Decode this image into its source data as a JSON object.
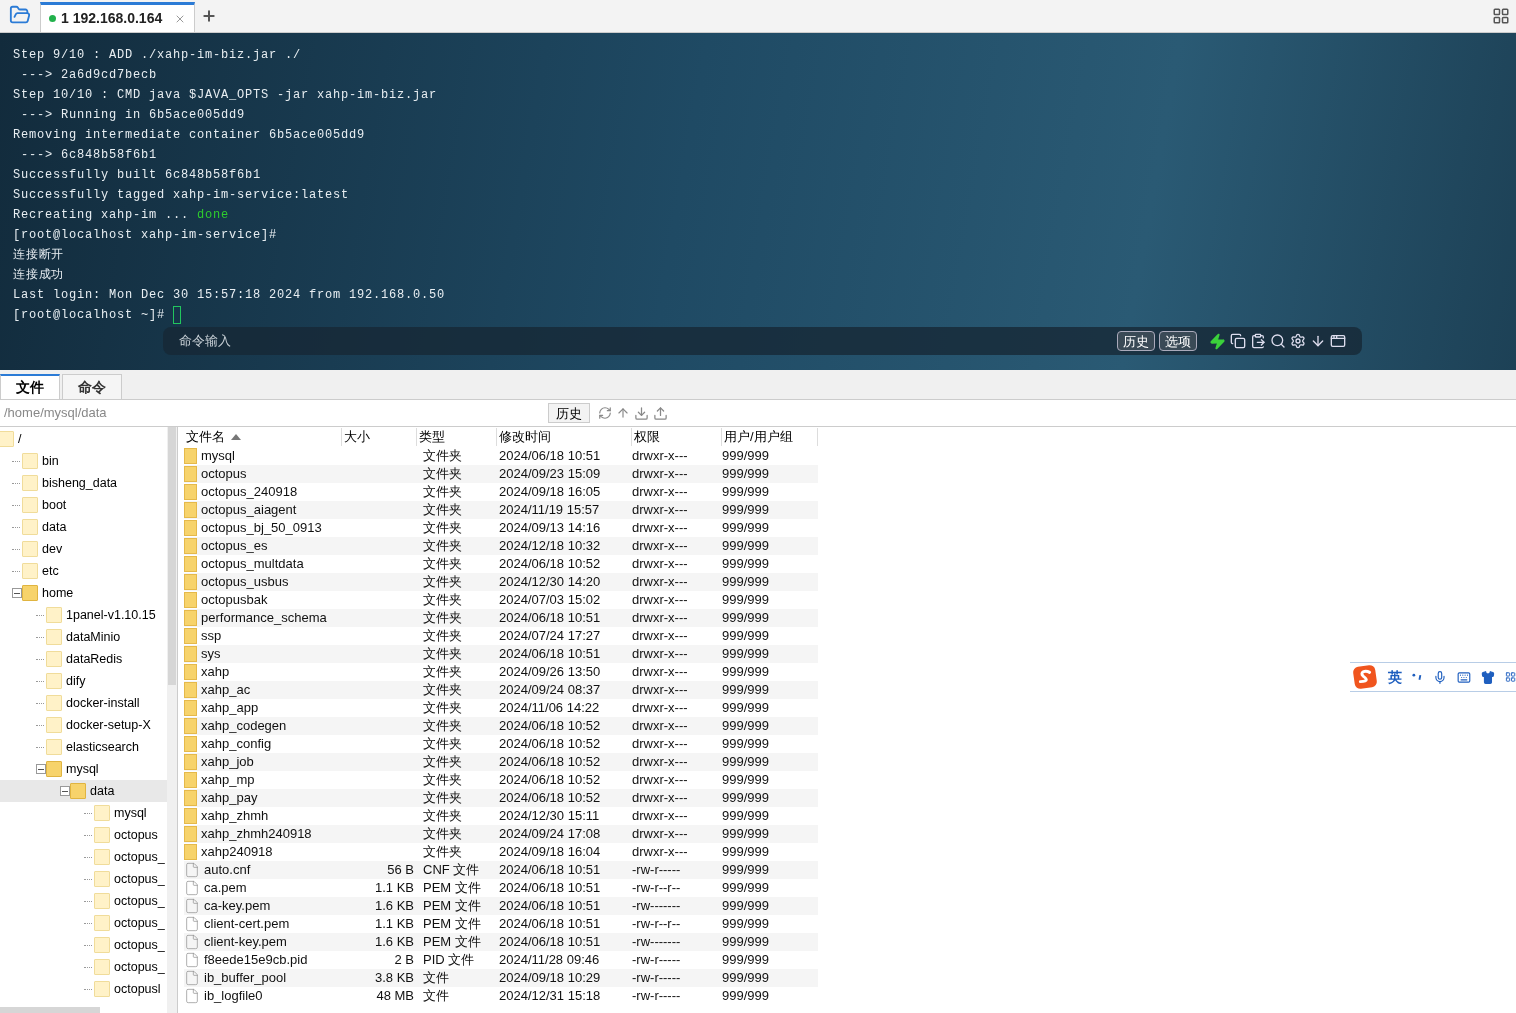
{
  "session_tabs": [
    {
      "label": "1 192.168.0.164",
      "connected": true,
      "selected": true
    }
  ],
  "terminal": {
    "lines": [
      {
        "text": "Step 9/10 : ADD ./xahp-im-biz.jar ./"
      },
      {
        "text": " ---> 2a6d9cd7becb"
      },
      {
        "text": "Step 10/10 : CMD java $JAVA_OPTS -jar xahp-im-biz.jar"
      },
      {
        "text": " ---> Running in 6b5ace005dd9"
      },
      {
        "text": "Removing intermediate container 6b5ace005dd9"
      },
      {
        "text": " ---> 6c848b58f6b1"
      },
      {
        "text": "Successfully built 6c848b58f6b1"
      },
      {
        "text": "Successfully tagged xahp-im-service:latest"
      },
      {
        "text": "Recreating xahp-im ... ",
        "status": "done"
      },
      {
        "text": "[root@localhost xahp-im-service]#"
      },
      {
        "text": "连接断开"
      },
      {
        "text": "连接成功"
      },
      {
        "text": "Last login: Mon Dec 30 15:57:18 2024 from 192.168.0.50"
      },
      {
        "text": "[root@localhost ~]# ",
        "cursor": true
      }
    ],
    "command_bar": {
      "placeholder": "命令输入",
      "buttons": [
        "历史",
        "选项"
      ]
    }
  },
  "panel_tabs": [
    {
      "label": "文件",
      "selected": true
    },
    {
      "label": "命令",
      "selected": false
    }
  ],
  "path_bar": {
    "value": "/home/mysql/data",
    "history_button": "历史"
  },
  "tree": [
    {
      "label": "/",
      "selected": false,
      "children": [
        {
          "label": "bin",
          "selected": false
        },
        {
          "label": "bisheng_data",
          "selected": false
        },
        {
          "label": "boot",
          "selected": false
        },
        {
          "label": "data",
          "selected": false
        },
        {
          "label": "dev",
          "selected": false
        },
        {
          "label": "etc",
          "selected": false
        },
        {
          "label": "home",
          "expanded": true,
          "selected": false,
          "children": [
            {
              "label": "1panel-v1.10.15",
              "selected": false
            },
            {
              "label": "dataMinio",
              "selected": false
            },
            {
              "label": "dataRedis",
              "selected": false
            },
            {
              "label": "dify",
              "selected": false
            },
            {
              "label": "docker-install",
              "selected": false
            },
            {
              "label": "docker-setup-X",
              "selected": false
            },
            {
              "label": "elasticsearch",
              "selected": false
            },
            {
              "label": "mysql",
              "expanded": true,
              "selected": false,
              "children": [
                {
                  "label": "data",
                  "expanded": true,
                  "selected": true,
                  "children": [
                    {
                      "label": "mysql",
                      "selected": false
                    },
                    {
                      "label": "octopus",
                      "selected": false
                    },
                    {
                      "label": "octopus_",
                      "selected": false
                    },
                    {
                      "label": "octopus_",
                      "selected": false
                    },
                    {
                      "label": "octopus_",
                      "selected": false
                    },
                    {
                      "label": "octopus_",
                      "selected": false
                    },
                    {
                      "label": "octopus_",
                      "selected": false
                    },
                    {
                      "label": "octopus_",
                      "selected": false
                    },
                    {
                      "label": "octopusl",
                      "selected": false
                    }
                  ]
                }
              ]
            }
          ]
        }
      ]
    }
  ],
  "table": {
    "columns": [
      {
        "label": "文件名",
        "sorted": true
      },
      {
        "label": "大小",
        "sorted": false
      },
      {
        "label": "类型",
        "sorted": false
      },
      {
        "label": "修改时间",
        "sorted": false
      },
      {
        "label": "权限",
        "sorted": false
      },
      {
        "label": "用户/用户组",
        "sorted": false
      }
    ],
    "rows": [
      {
        "kind": "folder",
        "name": "mysql",
        "type": "文件夹",
        "modified": "2024/06/18 10:51",
        "permissions": "drwxr-x---",
        "owner": "999/999"
      },
      {
        "kind": "folder",
        "name": "octopus",
        "type": "文件夹",
        "modified": "2024/09/23 15:09",
        "permissions": "drwxr-x---",
        "owner": "999/999"
      },
      {
        "kind": "folder",
        "name": "octopus_240918",
        "type": "文件夹",
        "modified": "2024/09/18 16:05",
        "permissions": "drwxr-x---",
        "owner": "999/999"
      },
      {
        "kind": "folder",
        "name": "octopus_aiagent",
        "type": "文件夹",
        "modified": "2024/11/19 15:57",
        "permissions": "drwxr-x---",
        "owner": "999/999"
      },
      {
        "kind": "folder",
        "name": "octopus_bj_50_0913",
        "type": "文件夹",
        "modified": "2024/09/13 14:16",
        "permissions": "drwxr-x---",
        "owner": "999/999"
      },
      {
        "kind": "folder",
        "name": "octopus_es",
        "type": "文件夹",
        "modified": "2024/12/18 10:32",
        "permissions": "drwxr-x---",
        "owner": "999/999"
      },
      {
        "kind": "folder",
        "name": "octopus_multdata",
        "type": "文件夹",
        "modified": "2024/06/18 10:52",
        "permissions": "drwxr-x---",
        "owner": "999/999"
      },
      {
        "kind": "folder",
        "name": "octopus_usbus",
        "type": "文件夹",
        "modified": "2024/12/30 14:20",
        "permissions": "drwxr-x---",
        "owner": "999/999"
      },
      {
        "kind": "folder",
        "name": "octopusbak",
        "type": "文件夹",
        "modified": "2024/07/03 15:02",
        "permissions": "drwxr-x---",
        "owner": "999/999"
      },
      {
        "kind": "folder",
        "name": "performance_schema",
        "type": "文件夹",
        "modified": "2024/06/18 10:51",
        "permissions": "drwxr-x---",
        "owner": "999/999"
      },
      {
        "kind": "folder",
        "name": "ssp",
        "type": "文件夹",
        "modified": "2024/07/24 17:27",
        "permissions": "drwxr-x---",
        "owner": "999/999"
      },
      {
        "kind": "folder",
        "name": "sys",
        "type": "文件夹",
        "modified": "2024/06/18 10:51",
        "permissions": "drwxr-x---",
        "owner": "999/999"
      },
      {
        "kind": "folder",
        "name": "xahp",
        "type": "文件夹",
        "modified": "2024/09/26 13:50",
        "permissions": "drwxr-x---",
        "owner": "999/999"
      },
      {
        "kind": "folder",
        "name": "xahp_ac",
        "type": "文件夹",
        "modified": "2024/09/24 08:37",
        "permissions": "drwxr-x---",
        "owner": "999/999"
      },
      {
        "kind": "folder",
        "name": "xahp_app",
        "type": "文件夹",
        "modified": "2024/11/06 14:22",
        "permissions": "drwxr-x---",
        "owner": "999/999"
      },
      {
        "kind": "folder",
        "name": "xahp_codegen",
        "type": "文件夹",
        "modified": "2024/06/18 10:52",
        "permissions": "drwxr-x---",
        "owner": "999/999"
      },
      {
        "kind": "folder",
        "name": "xahp_config",
        "type": "文件夹",
        "modified": "2024/06/18 10:52",
        "permissions": "drwxr-x---",
        "owner": "999/999"
      },
      {
        "kind": "folder",
        "name": "xahp_job",
        "type": "文件夹",
        "modified": "2024/06/18 10:52",
        "permissions": "drwxr-x---",
        "owner": "999/999"
      },
      {
        "kind": "folder",
        "name": "xahp_mp",
        "type": "文件夹",
        "modified": "2024/06/18 10:52",
        "permissions": "drwxr-x---",
        "owner": "999/999"
      },
      {
        "kind": "folder",
        "name": "xahp_pay",
        "type": "文件夹",
        "modified": "2024/06/18 10:52",
        "permissions": "drwxr-x---",
        "owner": "999/999"
      },
      {
        "kind": "folder",
        "name": "xahp_zhmh",
        "type": "文件夹",
        "modified": "2024/12/30 15:11",
        "permissions": "drwxr-x---",
        "owner": "999/999"
      },
      {
        "kind": "folder",
        "name": "xahp_zhmh240918",
        "type": "文件夹",
        "modified": "2024/09/24 17:08",
        "permissions": "drwxr-x---",
        "owner": "999/999"
      },
      {
        "kind": "folder",
        "name": "xahp240918",
        "type": "文件夹",
        "modified": "2024/09/18 16:04",
        "permissions": "drwxr-x---",
        "owner": "999/999"
      },
      {
        "kind": "file",
        "name": "auto.cnf",
        "size": "56 B",
        "type": "CNF 文件",
        "modified": "2024/06/18 10:51",
        "permissions": "-rw-r-----",
        "owner": "999/999"
      },
      {
        "kind": "file",
        "name": "ca.pem",
        "size": "1.1 KB",
        "type": "PEM 文件",
        "modified": "2024/06/18 10:51",
        "permissions": "-rw-r--r--",
        "owner": "999/999"
      },
      {
        "kind": "file",
        "name": "ca-key.pem",
        "size": "1.6 KB",
        "type": "PEM 文件",
        "modified": "2024/06/18 10:51",
        "permissions": "-rw-------",
        "owner": "999/999"
      },
      {
        "kind": "file",
        "name": "client-cert.pem",
        "size": "1.1 KB",
        "type": "PEM 文件",
        "modified": "2024/06/18 10:51",
        "permissions": "-rw-r--r--",
        "owner": "999/999"
      },
      {
        "kind": "file",
        "name": "client-key.pem",
        "size": "1.6 KB",
        "type": "PEM 文件",
        "modified": "2024/06/18 10:51",
        "permissions": "-rw-------",
        "owner": "999/999"
      },
      {
        "kind": "file",
        "name": "f8eede15e9cb.pid",
        "size": "2 B",
        "type": "PID 文件",
        "modified": "2024/11/28 09:46",
        "permissions": "-rw-r-----",
        "owner": "999/999"
      },
      {
        "kind": "file",
        "name": "ib_buffer_pool",
        "size": "3.8 KB",
        "type": "文件",
        "modified": "2024/09/18 10:29",
        "permissions": "-rw-r-----",
        "owner": "999/999"
      },
      {
        "kind": "file",
        "name": "ib_logfile0",
        "size": "48 MB",
        "type": "文件",
        "modified": "2024/12/31 15:18",
        "permissions": "-rw-r-----",
        "owner": "999/999"
      }
    ]
  },
  "ime_toolbar": {
    "mode": "英"
  }
}
